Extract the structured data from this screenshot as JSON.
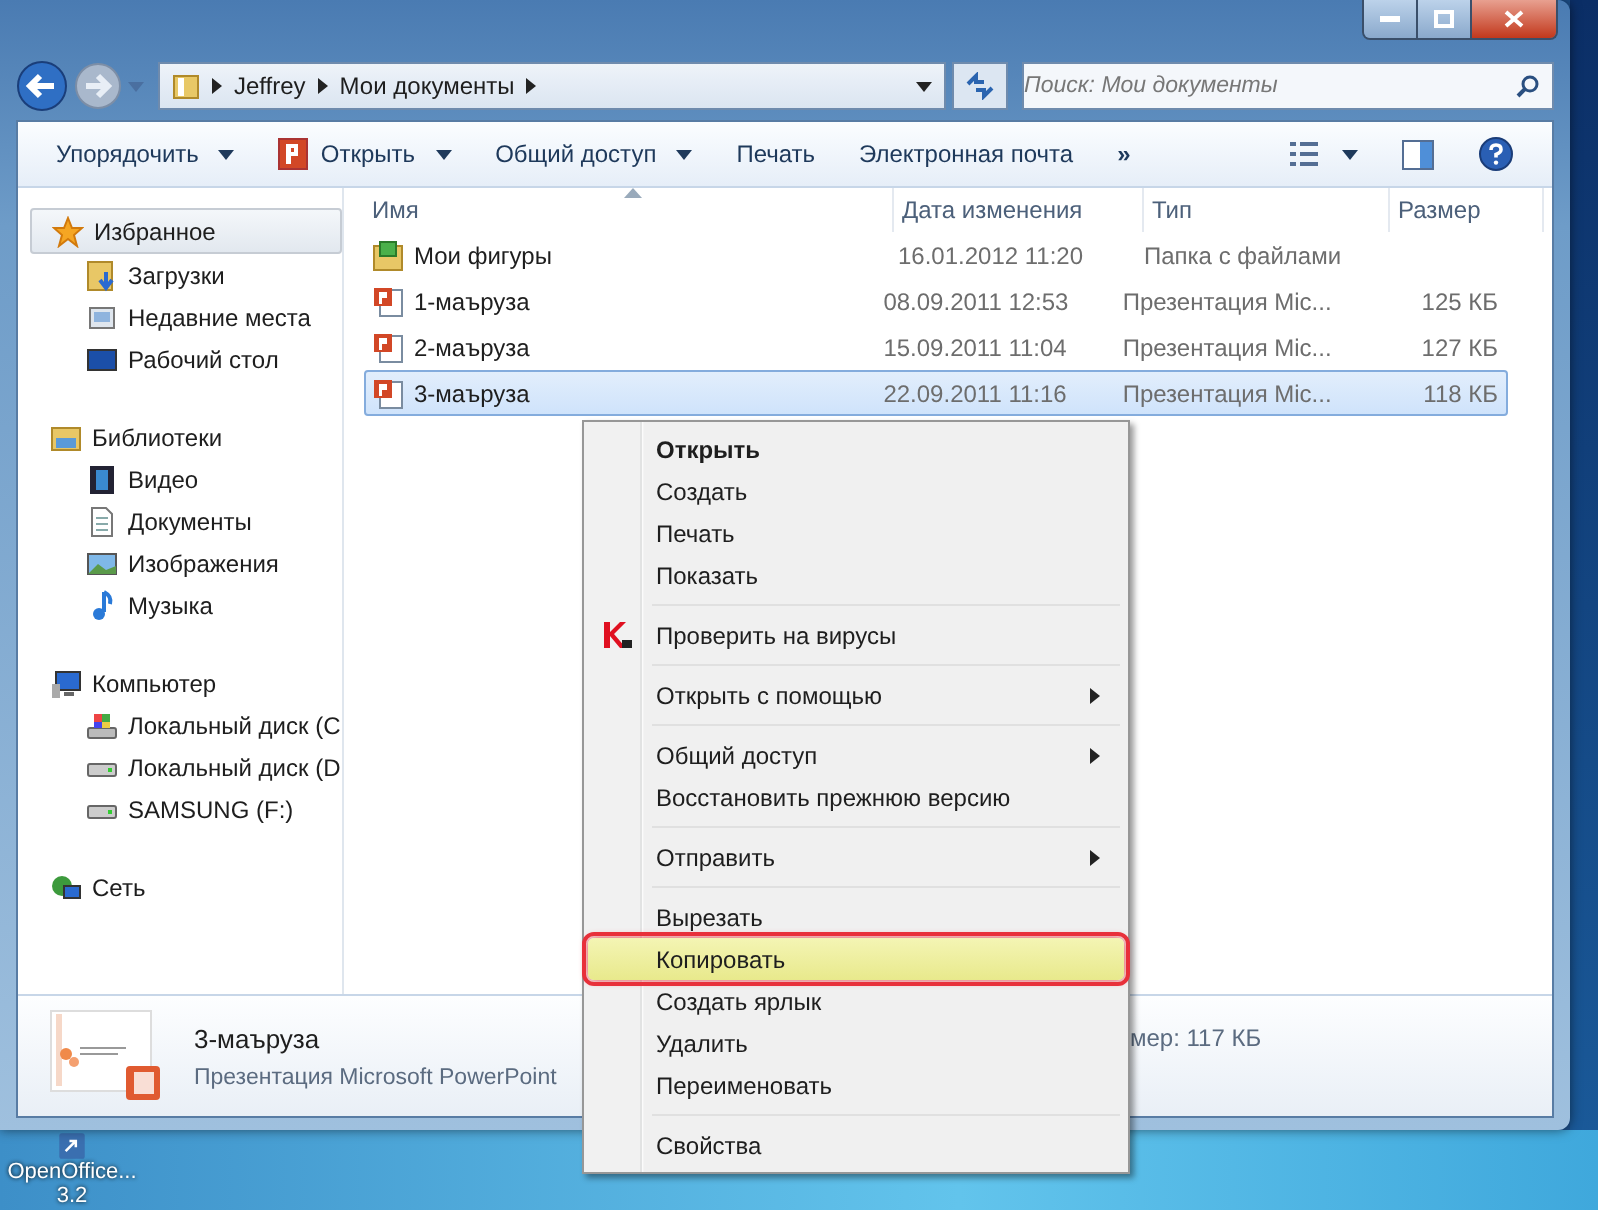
{
  "nav": {
    "breadcrumb": [
      "Jeffrey",
      "Мои документы"
    ],
    "search": {
      "placeholder": "Поиск: Мои документы"
    }
  },
  "toolbar": {
    "buttons": [
      {
        "label": "Упорядочить",
        "kind": "plain",
        "dropdown": true
      },
      {
        "label": "Открыть",
        "kind": "powerpoint",
        "dropdown": true
      },
      {
        "label": "Общий доступ",
        "kind": "plain",
        "dropdown": true
      },
      {
        "label": "Печать",
        "kind": "plain",
        "dropdown": false
      },
      {
        "label": "Электронная почта",
        "kind": "plain",
        "dropdown": false
      }
    ],
    "more": "»"
  },
  "sidebar": {
    "items": [
      {
        "label": "Избранное",
        "kind": "star",
        "selected": true,
        "children": [
          {
            "label": "Загрузки",
            "kind": "downloads",
            "selected": false
          },
          {
            "label": "Недавние места",
            "kind": "recent",
            "selected": false
          },
          {
            "label": "Рабочий стол",
            "kind": "desktop",
            "selected": false
          }
        ]
      },
      {
        "label": "Библиотеки",
        "kind": "library",
        "selected": false,
        "children": [
          {
            "label": "Видео",
            "kind": "video",
            "selected": false
          },
          {
            "label": "Документы",
            "kind": "document",
            "selected": false
          },
          {
            "label": "Изображения",
            "kind": "image",
            "selected": false
          },
          {
            "label": "Музыка",
            "kind": "music",
            "selected": false
          }
        ]
      },
      {
        "label": "Компьютер",
        "kind": "computer",
        "selected": false,
        "children": [
          {
            "label": "Локальный диск (C",
            "kind": "system-drive",
            "selected": false
          },
          {
            "label": "Локальный диск (D",
            "kind": "drive",
            "selected": false
          },
          {
            "label": "SAMSUNG (F:)",
            "kind": "drive",
            "selected": false
          }
        ]
      },
      {
        "label": "Сеть",
        "kind": "network",
        "selected": false
      }
    ]
  },
  "table": {
    "columns": [
      "Имя",
      "Дата изменения",
      "Тип",
      "Размер"
    ],
    "rows": [
      {
        "name": "Мои фигуры",
        "kind": "folder",
        "date": "16.01.2012 11:20",
        "type": "Папка с файлами",
        "selected": false
      },
      {
        "name": "1-маъруза",
        "kind": "powerpoint",
        "date": "08.09.2011 12:53",
        "type": "Презентация Mic...",
        "size": "125 КБ",
        "selected": false
      },
      {
        "name": "2-маъруза",
        "kind": "powerpoint",
        "date": "15.09.2011 11:04",
        "type": "Презентация Mic...",
        "size": "127 КБ",
        "selected": false
      },
      {
        "name": "3-маъруза",
        "kind": "powerpoint",
        "date": "22.09.2011 11:16",
        "type": "Презентация Mic...",
        "size": "118 КБ",
        "selected": true
      }
    ]
  },
  "details": {
    "name": "3-маъруза",
    "type": "Презентация Microsoft PowerPoint",
    "size": "мер: 117 КБ"
  },
  "context_menu": {
    "groups": [
      {
        "items": [
          {
            "label": "Открыть",
            "kind": "default",
            "submenu": false,
            "selected": false
          },
          {
            "label": "Создать",
            "kind": "plain",
            "submenu": false,
            "selected": false
          },
          {
            "label": "Печать",
            "kind": "plain",
            "submenu": false,
            "selected": false
          },
          {
            "label": "Показать",
            "kind": "plain",
            "submenu": false,
            "selected": false
          }
        ]
      },
      {
        "items": [
          {
            "label": "Проверить на вирусы",
            "kind": "antivirus",
            "submenu": false,
            "selected": false
          }
        ]
      },
      {
        "items": [
          {
            "label": "Открыть с помощью",
            "kind": "plain",
            "submenu": true,
            "selected": false
          }
        ]
      },
      {
        "items": [
          {
            "label": "Общий доступ",
            "kind": "plain",
            "submenu": true,
            "selected": false
          },
          {
            "label": "Восстановить прежнюю версию",
            "kind": "plain",
            "submenu": false,
            "selected": false
          }
        ]
      },
      {
        "items": [
          {
            "label": "Отправить",
            "kind": "plain",
            "submenu": true,
            "selected": false
          }
        ]
      },
      {
        "items": [
          {
            "label": "Вырезать",
            "kind": "plain",
            "submenu": false,
            "selected": false
          },
          {
            "label": "Копировать",
            "kind": "plain",
            "submenu": false,
            "selected": true
          },
          {
            "label": "Создать ярлык",
            "kind": "plain",
            "submenu": false,
            "selected": false
          },
          {
            "label": "Удалить",
            "kind": "plain",
            "submenu": false,
            "selected": false
          },
          {
            "label": "Переименовать",
            "kind": "plain",
            "submenu": false,
            "selected": false
          }
        ]
      },
      {
        "items": [
          {
            "label": "Свойства",
            "kind": "plain",
            "submenu": false,
            "selected": false
          }
        ]
      }
    ]
  },
  "desktop": {
    "icons": [
      {
        "lines": [
          "OpenOffice...",
          "3.2"
        ]
      }
    ]
  }
}
